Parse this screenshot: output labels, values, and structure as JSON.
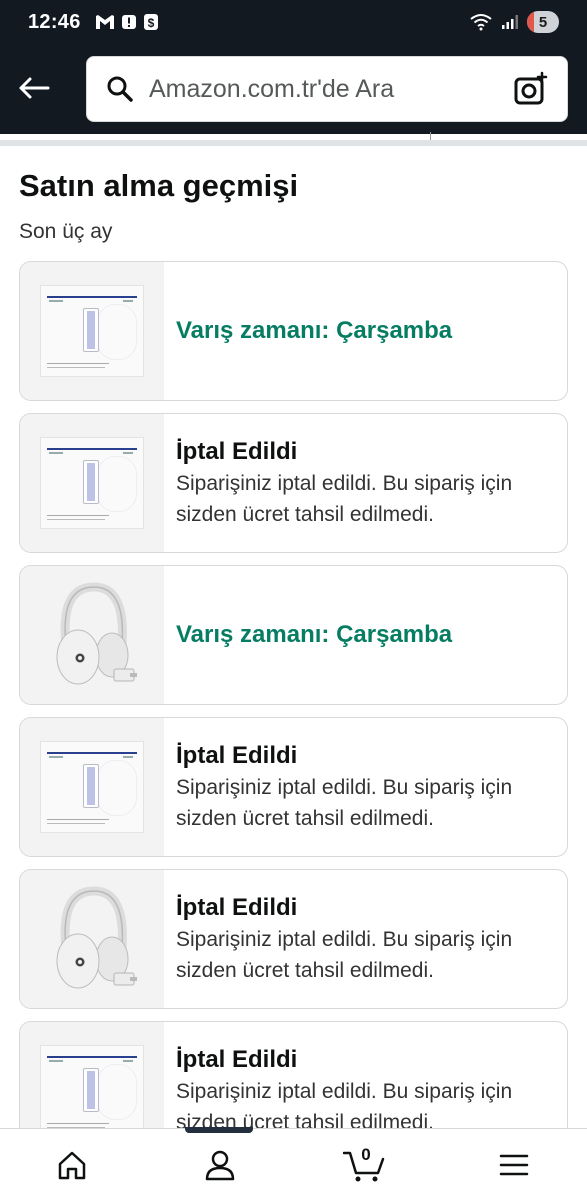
{
  "status_bar": {
    "time": "12:46",
    "notification_icons": [
      "gmail-icon",
      "alert-icon",
      "dollar-icon"
    ],
    "battery_level": "5"
  },
  "header": {
    "search_placeholder": "Amazon.com.tr'de Ara"
  },
  "page": {
    "title": "Satın alma geçmişi",
    "subtitle": "Son üç ay"
  },
  "orders": [
    {
      "product": "playstation-disc-drive",
      "status": "Varış zamanı: Çarşamba",
      "type": "delivery",
      "description": ""
    },
    {
      "product": "playstation-disc-drive",
      "status": "İptal Edildi",
      "type": "cancelled",
      "description": "Siparişiniz iptal edildi. Bu sipariş için sizden ücret tahsil edilmedi."
    },
    {
      "product": "white-wireless-headset",
      "status": "Varış zamanı: Çarşamba",
      "type": "delivery",
      "description": ""
    },
    {
      "product": "playstation-disc-drive",
      "status": "İptal Edildi",
      "type": "cancelled",
      "description": "Siparişiniz iptal edildi. Bu sipariş için sizden ücret tahsil edilmedi."
    },
    {
      "product": "white-wireless-headset",
      "status": "İptal Edildi",
      "type": "cancelled",
      "description": "Siparişiniz iptal edildi. Bu sipariş için sizden ücret tahsil edilmedi."
    },
    {
      "product": "playstation-disc-drive",
      "status": "İptal Edildi",
      "type": "cancelled",
      "description": "Siparişiniz iptal edildi. Bu sipariş için sizden ücret tahsil edilmedi."
    }
  ],
  "bottom_nav": {
    "cart_count": "0",
    "items": [
      "home-icon",
      "account-icon",
      "cart-icon",
      "menu-icon"
    ]
  },
  "colors": {
    "header_bg": "#131921",
    "delivery_text": "#067d62",
    "card_border": "#d5d9d9"
  }
}
